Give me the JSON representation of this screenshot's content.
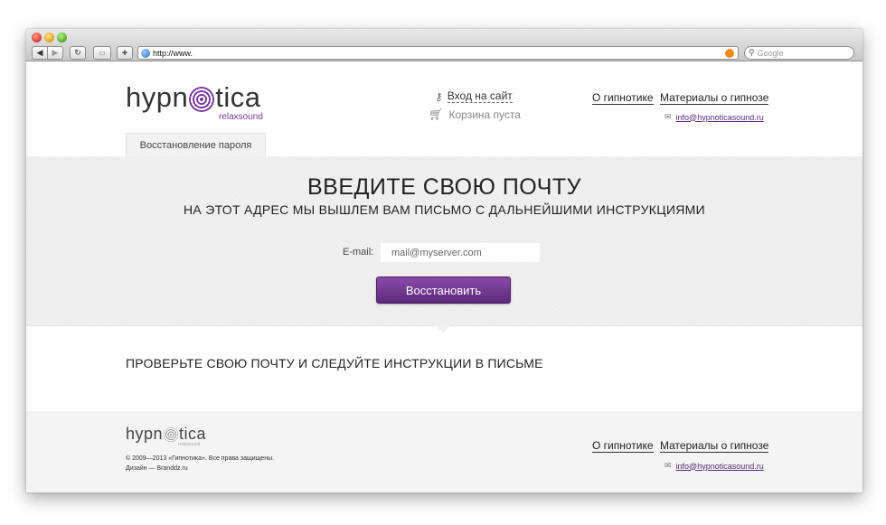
{
  "browser": {
    "url": "http://www.",
    "search_placeholder": "Google",
    "back_glyph": "◀",
    "forward_glyph": "▶",
    "reload_glyph": "↻",
    "bookmarks_glyph": "▭",
    "add_glyph": "+"
  },
  "logo": {
    "prefix": "hypn",
    "suffix": "tica",
    "sub": "relaxsound"
  },
  "header": {
    "login": "Вход на сайт",
    "cart": "Корзина пуста",
    "nav": [
      {
        "label": "О гипнотике"
      },
      {
        "label": "Материалы о гипнозе"
      }
    ],
    "email": "info@hypnoticasound.ru"
  },
  "tab": {
    "label": "Восстановление пароля"
  },
  "form": {
    "title": "ВВЕДИТЕ СВОЮ ПОЧТУ",
    "subtitle": "НА ЭТОТ АДРЕС МЫ ВЫШЛЕМ ВАМ ПИСЬМО С ДАЛЬНЕЙШИМИ ИНСТРУКЦИЯМИ",
    "email_label": "E-mail:",
    "email_placeholder": "mail@myserver.com",
    "submit": "Восстановить"
  },
  "instructions": "ПРОВЕРЬТЕ СВОЮ ПОЧТУ И СЛЕДУЙТЕ ИНСТРУКЦИИ В ПИСЬМЕ",
  "footer": {
    "copyright": "© 2009—2013 «Гипнотика». Все права защищены.",
    "design": "Дизайн — Branddz.ru",
    "nav": [
      {
        "label": "О гипнотике"
      },
      {
        "label": "Материалы о гипнозе"
      }
    ],
    "email": "info@hypnoticasound.ru"
  },
  "colors": {
    "accent": "#6a3590",
    "hero_bg": "#f0f0f0",
    "footer_bg": "#f4f4f4"
  }
}
